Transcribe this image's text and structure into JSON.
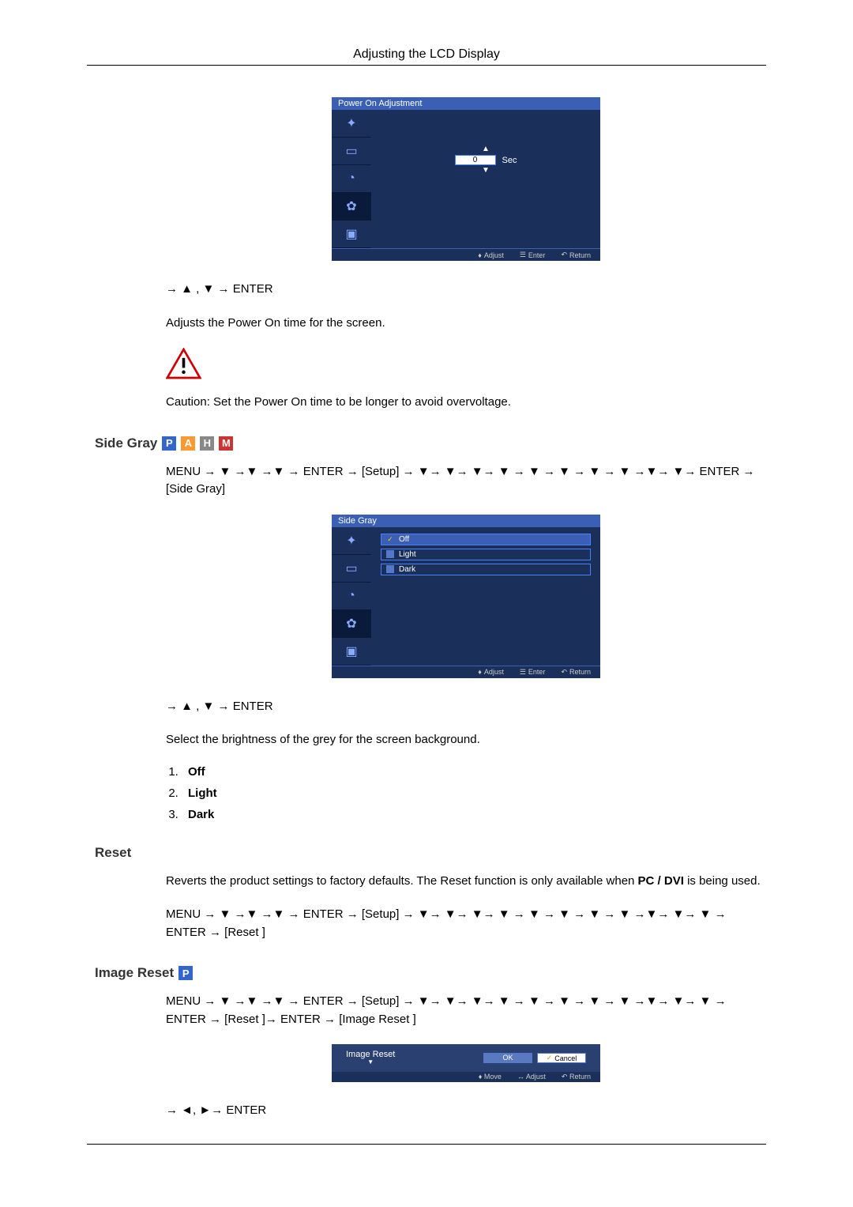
{
  "header": {
    "title": "Adjusting the LCD Display"
  },
  "osd1": {
    "title": "Power On Adjustment",
    "value": "0",
    "unit": "Sec",
    "footer": {
      "adjust": "Adjust",
      "enter": "Enter",
      "return": "Return"
    }
  },
  "nav_line1": "→ ▲ , ▼ → ENTER",
  "desc1": "Adjusts the Power On time for the screen.",
  "caution1": "Caution: Set the Power On time to be longer to avoid overvoltage.",
  "section_sidegray": {
    "title": "Side Gray",
    "menu_path": "MENU → ▼ →▼ →▼ → ENTER → [Setup] → ▼→ ▼→ ▼→ ▼ → ▼ → ▼ → ▼ → ▼ →▼→ ▼→ ENTER → [Side Gray]",
    "osd_title": "Side Gray",
    "options": [
      "Off",
      "Light",
      "Dark"
    ],
    "footer": {
      "adjust": "Adjust",
      "enter": "Enter",
      "return": "Return"
    },
    "nav_line": "→ ▲ , ▼ → ENTER",
    "desc": "Select the brightness of the grey for the screen background.",
    "list": {
      "1": "Off",
      "2": "Light",
      "3": "Dark"
    }
  },
  "section_reset": {
    "title": "Reset",
    "desc_a": "Reverts the product settings to factory defaults. The Reset function is only available when ",
    "desc_b": "PC / DVI",
    "desc_c": " is being used.",
    "menu_path": "MENU → ▼ →▼ →▼ → ENTER → [Setup] → ▼→ ▼→ ▼→ ▼ → ▼ → ▼ → ▼ → ▼ →▼→ ▼→ ▼ → ENTER → [Reset ]"
  },
  "section_imagereset": {
    "title": "Image Reset",
    "menu_path": "MENU → ▼ →▼ →▼ → ENTER → [Setup] → ▼→ ▼→ ▼→ ▼ → ▼ → ▼ → ▼ → ▼ →▼→ ▼→ ▼ → ENTER → [Reset ]→ ENTER → [Image Reset ]",
    "osd_label": "Image Reset",
    "ok": "OK",
    "cancel": "Cancel",
    "footer": {
      "move": "Move",
      "adjust": "Adjust",
      "return": "Return"
    },
    "nav_line": "→ ◄, ►→ ENTER"
  }
}
